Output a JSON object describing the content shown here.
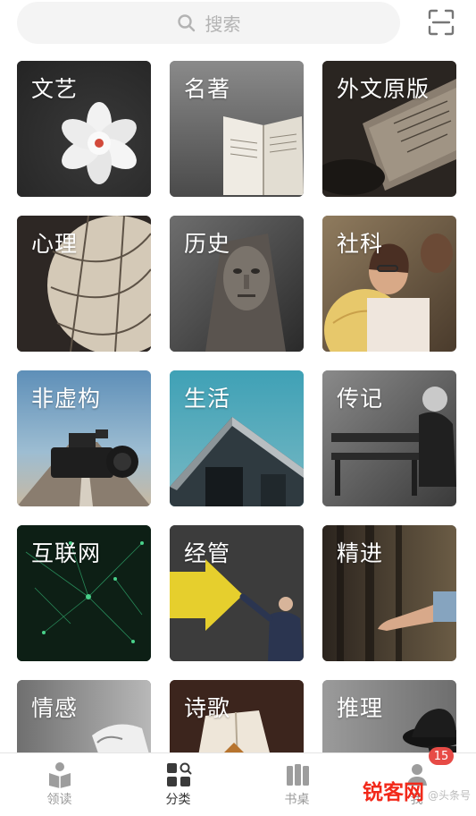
{
  "search": {
    "placeholder": "搜索"
  },
  "categories": [
    {
      "label": "文艺"
    },
    {
      "label": "名著"
    },
    {
      "label": "外文原版"
    },
    {
      "label": "心理"
    },
    {
      "label": "历史"
    },
    {
      "label": "社科"
    },
    {
      "label": "非虚构"
    },
    {
      "label": "生活"
    },
    {
      "label": "传记"
    },
    {
      "label": "互联网"
    },
    {
      "label": "经管"
    },
    {
      "label": "精进"
    },
    {
      "label": "情感"
    },
    {
      "label": "诗歌"
    },
    {
      "label": "推理"
    }
  ],
  "bottom_nav": {
    "items": [
      {
        "label": "领读"
      },
      {
        "label": "分类"
      },
      {
        "label": "书桌"
      },
      {
        "label": "我"
      }
    ],
    "badge": "15"
  },
  "watermark": {
    "text": "锐客网",
    "subtext": "@头条号"
  },
  "colors": {
    "accent_red": "#f2291a",
    "badge_red": "#e74b46",
    "inactive_text": "#999999",
    "active_text": "#333333"
  }
}
